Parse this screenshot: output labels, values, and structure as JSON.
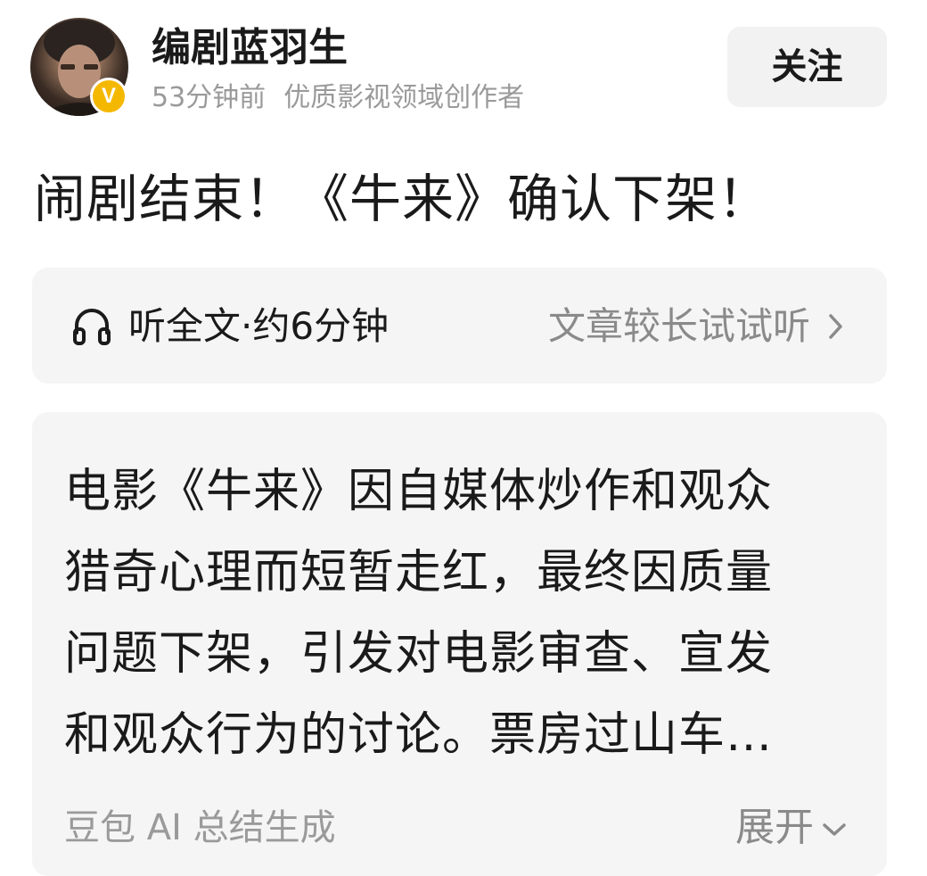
{
  "author": {
    "name": "编剧蓝羽生",
    "badge": "V",
    "time": "53分钟前",
    "tag": "优质影视领域创作者"
  },
  "follow_label": "关注",
  "article": {
    "title": "闹剧结束！《牛来》确认下架！"
  },
  "listen": {
    "icon": "headphones-icon",
    "label": "听全文·约6分钟",
    "hint": "文章较长试试听"
  },
  "summary": {
    "lines": [
      "电影《牛来》因自媒体炒作和观众",
      "猎奇心理而短暂走红，最终因质量",
      "问题下架，引发对电影审查、宣发",
      "和观众行为的讨论。票房过山车…"
    ],
    "source": "豆包 AI 总结生成",
    "expand_label": "展开"
  },
  "colors": {
    "badge": "#f5b800",
    "card_bg": "#f5f5f5",
    "muted_text": "#9a9a9a"
  }
}
